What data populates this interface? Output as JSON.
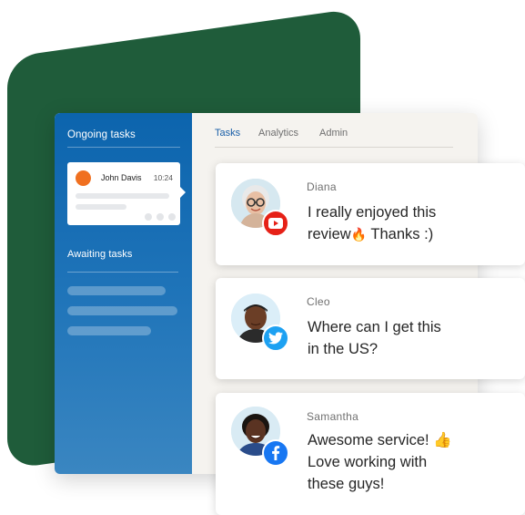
{
  "sidebar": {
    "ongoing_title": "Ongoing tasks",
    "awaiting_title": "Awaiting tasks",
    "task_card": {
      "name": "John Davis",
      "time": "10:24"
    }
  },
  "tabs": [
    {
      "label": "Tasks",
      "active": true
    },
    {
      "label": "Analytics",
      "active": false
    },
    {
      "label": "Admin",
      "active": false
    }
  ],
  "messages": [
    {
      "name": "Diana",
      "line1": "I really enjoyed this",
      "line2a": "review",
      "emoji": "🔥",
      "line2b": " Thanks :)",
      "platform": "youtube-icon"
    },
    {
      "name": "Cleo",
      "line1": "Where can I get this",
      "line2": "in the US?",
      "platform": "twitter-icon"
    },
    {
      "name": "Samantha",
      "line1": "Awesome service! 👍",
      "line2": "Love working with",
      "line3": "these guys!",
      "platform": "facebook-icon"
    }
  ],
  "colors": {
    "green": "#1f5c3a",
    "sidebar_blue": "#0c64ad",
    "active_tab": "#1a5fa8",
    "youtube": "#e62117",
    "twitter": "#1da1f2",
    "facebook": "#1877f2",
    "avatar_dot": "#f07020"
  }
}
